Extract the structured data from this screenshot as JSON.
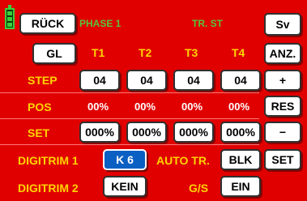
{
  "header": {
    "back_label": "RÜCK",
    "phase_label": "PHASE 1",
    "mode_label": "TR. ST",
    "save_label": "Sv"
  },
  "top_row": {
    "gl_label": "GL",
    "t_labels": [
      "T1",
      "T2",
      "T3",
      "T4"
    ],
    "anz_label": "ANZ."
  },
  "step_row": {
    "label": "STEP",
    "values": [
      "04",
      "04",
      "04",
      "04"
    ],
    "plus_label": "+"
  },
  "pos_row": {
    "label": "POS",
    "values": [
      "00%",
      "00%",
      "00%",
      "00%"
    ],
    "res_label": "RES"
  },
  "set_row": {
    "label": "SET",
    "values": [
      "000%",
      "000%",
      "000%",
      "000%"
    ],
    "minus_label": "−"
  },
  "digitrim1": {
    "label": "DIGITRIM 1",
    "value": "K 6",
    "autotr_label": "AUTO TR.",
    "autotr_value": "BLK",
    "set_label": "SET"
  },
  "digitrim2": {
    "label": "DIGITRIM 2",
    "value": "KEIN",
    "gs_label": "G/S",
    "gs_value": "EIN"
  },
  "colors": {
    "background": "#e00000",
    "label_yellow": "#ffd400",
    "label_green": "#59c43a",
    "selected_blue": "#0a5fc2"
  }
}
